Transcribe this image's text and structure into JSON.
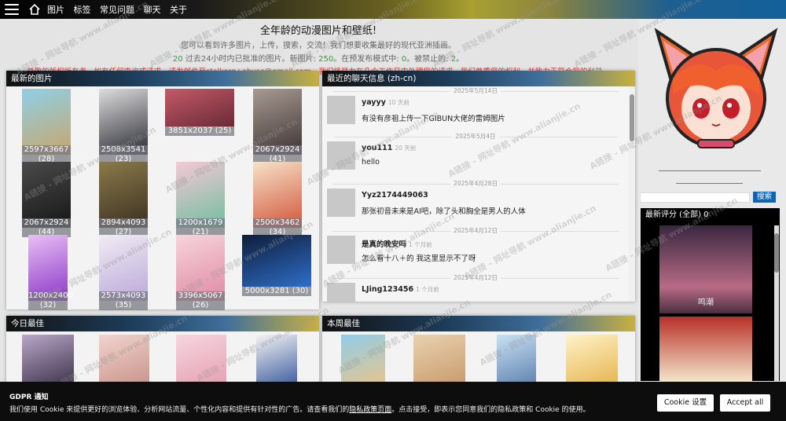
{
  "nav": {
    "items": [
      "图片",
      "标签",
      "常见问题",
      "聊天",
      "关于"
    ]
  },
  "intro": {
    "title": "全年龄的动漫图片和壁纸!",
    "subtitle": "您可以看到许多图片，上传，搜索，交流！我们想要收集最好的现代亚洲插画。",
    "stats_a": "20",
    "stats_b": " 过去24小时内已批准的图片。新图片: ",
    "stats_c": "250",
    "stats_d": "。在预发布模式中: ",
    "stats_e": "0",
    "stats_f": "。被禁止的: ",
    "stats_g": "2",
    "stats_h": "。",
    "warning": "尊敬的版权所有者，如有任何查询或请求，请发邮件至stalkerg+abuse@gmail.com。我们将尽力在几个工作日内处理您的请求。我们尊重您的权利，并致力于符合您的利益。"
  },
  "latest": {
    "header": "最新的图片",
    "items": [
      "2597x3667 (28)",
      "2508x3541 (23)",
      "3851x2037 (25)",
      "2067x2924 (41)",
      "2067x2924 (44)",
      "2894x4093 (27)",
      "1200x1679 (21)",
      "2500x3462 (34)",
      "1200x2400 (32)",
      "2573x4093 (35)",
      "3396x5067 (26)",
      "5000x3281 (30)"
    ]
  },
  "chat": {
    "header": "最近的聊天信息 (zh-cn)",
    "messages": [
      {
        "date": "2025年5月14日",
        "user": "yayyy",
        "ago": "10 天前",
        "text": "有没有彦祖上传一下GIBUN大佬的雷姆图片"
      },
      {
        "date": "2025年5月4日",
        "user": "you111",
        "ago": "20 天前",
        "text": "hello"
      },
      {
        "date": "2025年4月28日",
        "user": "Yyz2174449063",
        "ago": "",
        "text": "那张初音未来是AI吧，除了头和胸全是男人的人体"
      },
      {
        "date": "2025年4月12日",
        "user": "是真的晚安吗",
        "ago": "1 个月前",
        "text": "怎么看十八＋的 我这里显示不了呀"
      },
      {
        "date": "2025年4月12日",
        "user": "LJing123456",
        "ago": "1 个月前",
        "text": ""
      }
    ]
  },
  "today": {
    "header": "今日最佳"
  },
  "week": {
    "header": "本周最佳"
  },
  "sidebar": {
    "search_button": "搜索",
    "rating_header": "最新评分 (全部) 0",
    "rating_caption": "鸣潮"
  },
  "gdpr": {
    "title": "GDPR 通知",
    "desc_a": "我们使用 Cookie 来提供更好的浏览体验、分析网站流量、个性化内容和提供有针对性的广告。请查看我们的",
    "desc_link": "隐私政策页面",
    "desc_b": "。点击接受，即表示您同意我们的隐私政策和 Cookie 的使用。",
    "settings": "Cookie 设置",
    "accept": "Accept all"
  },
  "watermark": "A链接 - 网址导航 www.alianjie.cn",
  "colors": {
    "accent_blue": "#1264b0",
    "green": "#2aa52a",
    "red": "#e8392e"
  }
}
